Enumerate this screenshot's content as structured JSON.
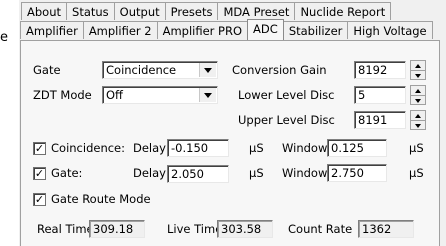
{
  "edge_text": "e",
  "tabs_back": [
    "About",
    "Status",
    "Output",
    "Presets",
    "MDA Preset",
    "Nuclide Report"
  ],
  "tabs_front": [
    "Amplifier",
    "Amplifier 2",
    "Amplifier PRO",
    "ADC",
    "Stabilizer",
    "High Voltage"
  ],
  "active_tab": "ADC",
  "gate": {
    "label": "Gate",
    "value": "Coincidence"
  },
  "zdt": {
    "label": "ZDT Mode",
    "value": "Off"
  },
  "conversion_gain": {
    "label": "Conversion Gain",
    "value": "8192"
  },
  "lower_level": {
    "label": "Lower Level Disc",
    "value": "5"
  },
  "upper_level": {
    "label": "Upper Level Disc",
    "value": "8191"
  },
  "coincidence": {
    "label": "Coincidence:",
    "checked": true,
    "check_mark": "✓",
    "delay_label": "Delay",
    "delay": "-0.150",
    "delay_unit": "µS",
    "window_label": "Window",
    "window": "0.125",
    "window_unit": "µS"
  },
  "gate_row": {
    "label": "Gate:",
    "checked": true,
    "check_mark": "✓",
    "delay_label": "Delay",
    "delay": "2.050",
    "delay_unit": "µS",
    "window_label": "Window",
    "window": "2.750",
    "window_unit": "µS"
  },
  "gate_route": {
    "label": "Gate Route Mode",
    "checked": true,
    "check_mark": "✓"
  },
  "status": {
    "real_time_label": "Real Time",
    "real_time": "309.18",
    "live_time_label": "Live Time",
    "live_time": "303.58",
    "count_rate_label": "Count Rate",
    "count_rate": "1362"
  }
}
